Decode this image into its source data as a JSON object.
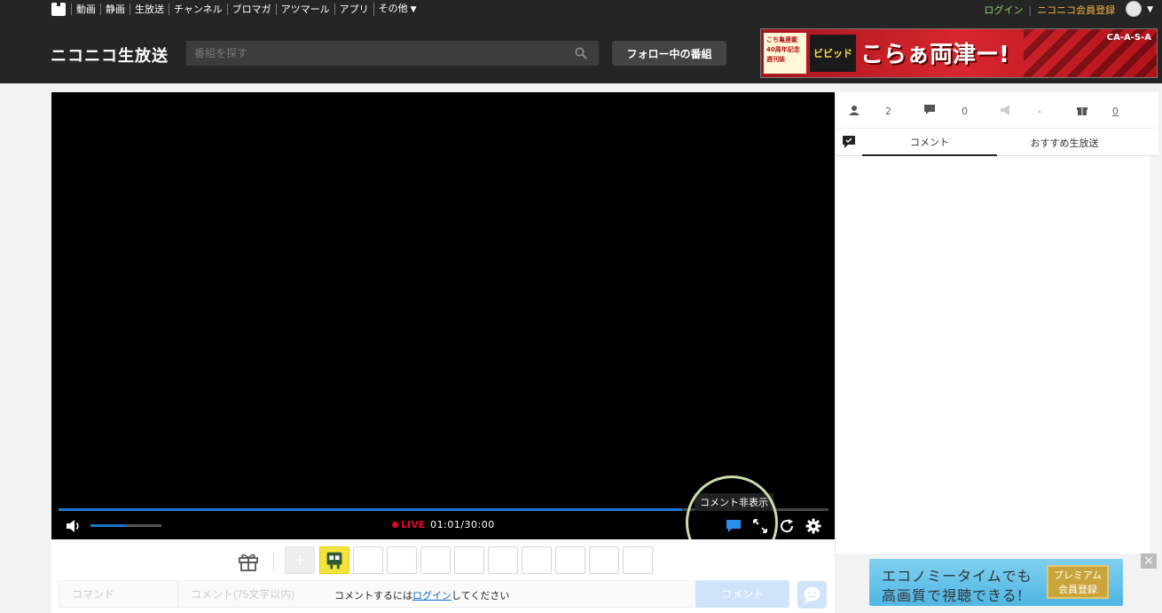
{
  "topnav": {
    "menu": [
      "動画",
      "静画",
      "生放送",
      "チャンネル",
      "ブロマガ",
      "アツマール",
      "アプリ",
      "その他"
    ],
    "login": "ログイン",
    "separator": "|",
    "register": "ニコニコ会員登録"
  },
  "header": {
    "site_title": "ニコニコ生放送",
    "search_placeholder": "番組を探す",
    "follow_button": "フォロー中の番組",
    "banner": {
      "left_text": "こち亀連載 40周年記念 週刊誌",
      "mid_text": "ビビッド",
      "title": "こらぁ両津ー!",
      "corner_text": "CA-A-S-A"
    }
  },
  "player": {
    "live_label": "LIVE",
    "time": "01:01/30:00",
    "progress": 0.81,
    "volume": 0.5,
    "tooltip": "コメント非表示"
  },
  "comment_area": {
    "command_placeholder": "コマンド",
    "comment_placeholder": "コメント(75文字以内)",
    "login_prefix": "コメントするには",
    "login_link": "ログイン",
    "login_suffix": "してください",
    "comment_button": "コメント",
    "add_symbol": "+"
  },
  "sidebar": {
    "stats": {
      "viewers": "2",
      "comments": "0",
      "ad": "-",
      "gifts": "0"
    },
    "tabs": {
      "comment": "コメント",
      "recommend": "おすすめ生放送"
    }
  },
  "ad": {
    "line1": "エコノミータイムでも",
    "line2": "高画質で視聴できる!",
    "badge_line1": "プレミアム",
    "badge_line2": "会員登録",
    "close": "×"
  },
  "colors": {
    "accent_blue": "#1a76d2",
    "live_red": "#e6002d",
    "nav_bg": "#252525",
    "login_green": "#8fd36a",
    "register_orange": "#f3b33d"
  }
}
